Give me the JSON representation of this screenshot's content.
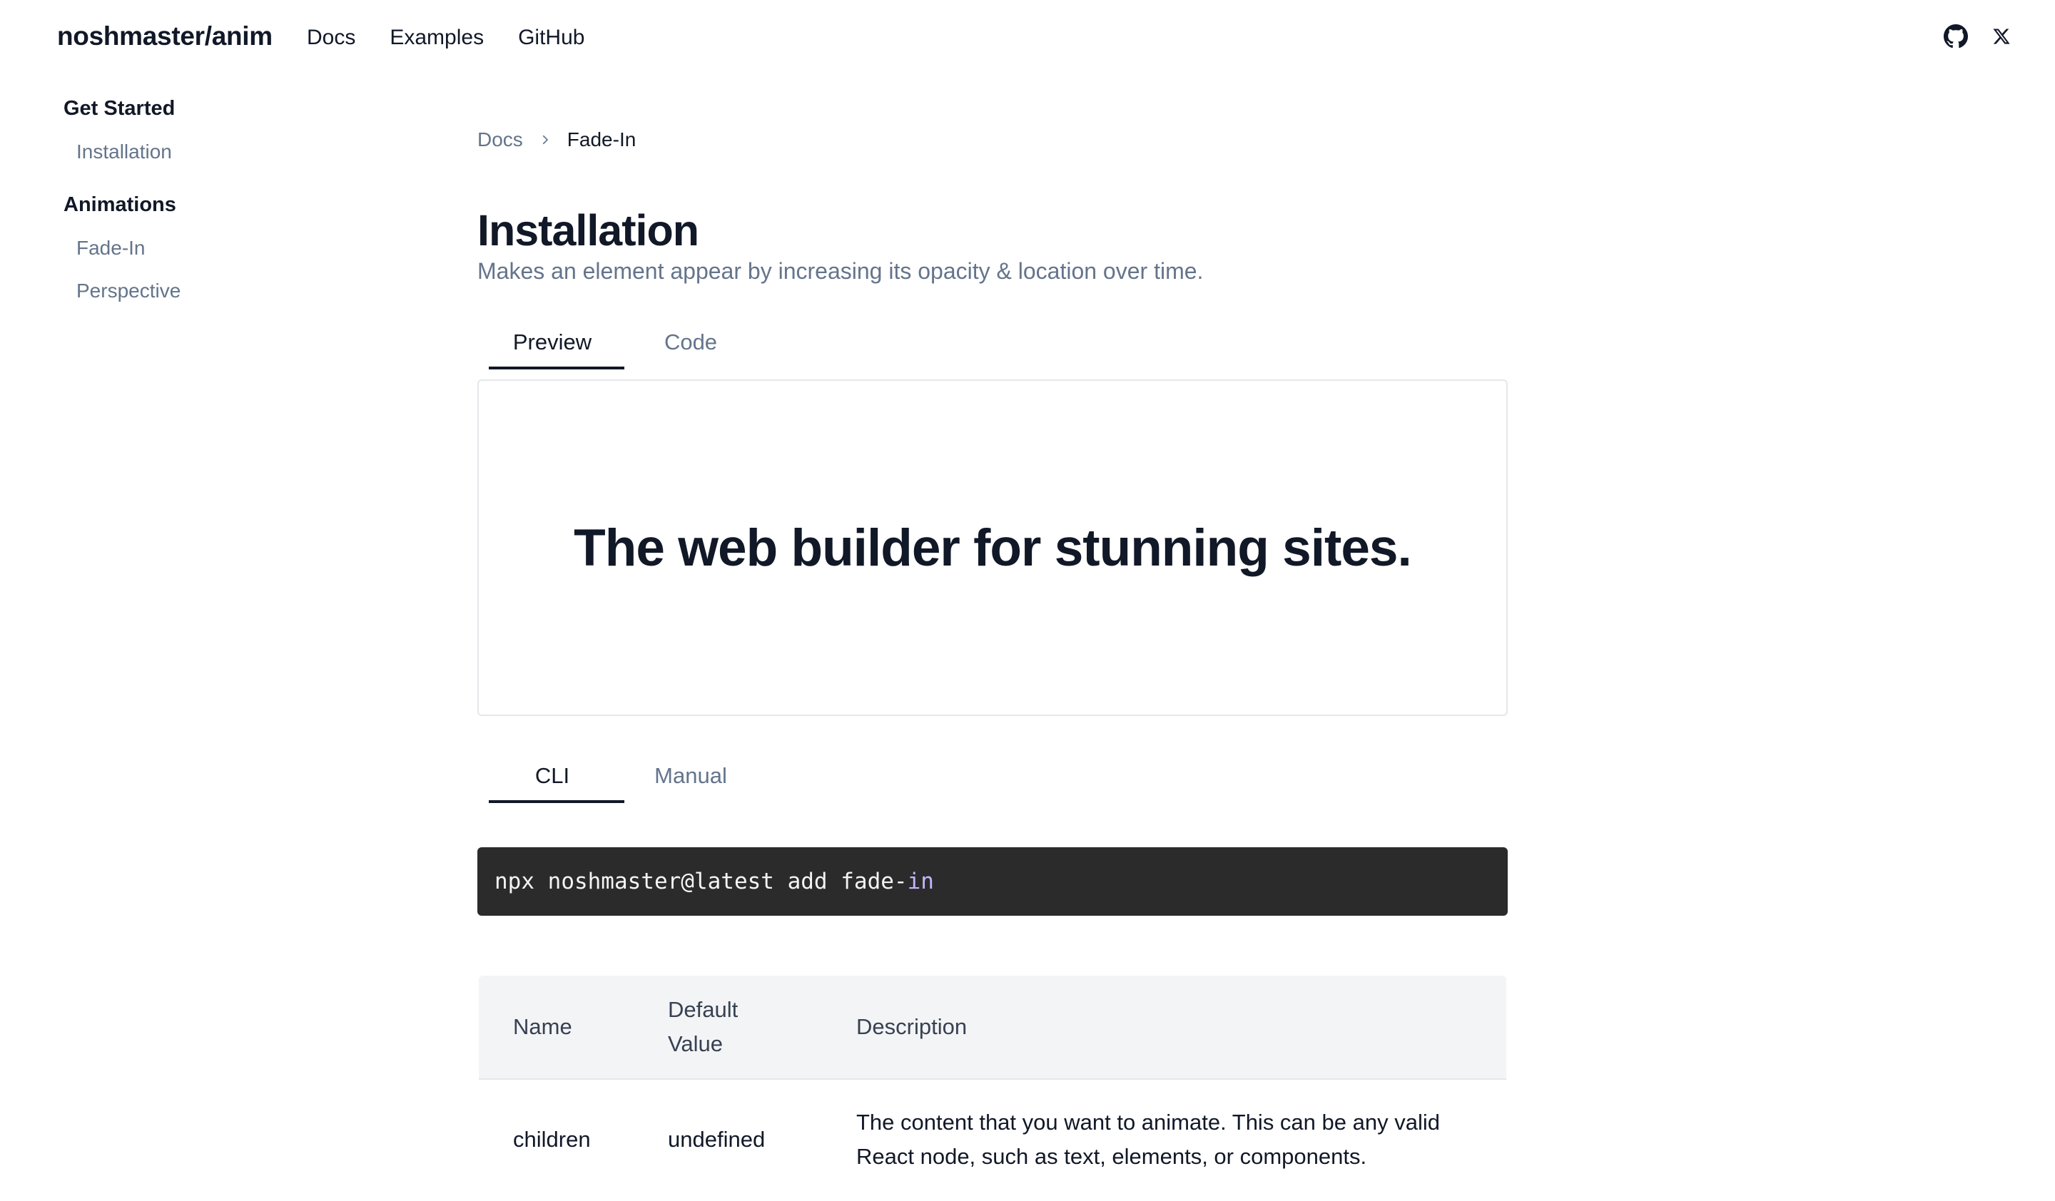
{
  "header": {
    "brand": "noshmaster/anim",
    "nav": [
      "Docs",
      "Examples",
      "GitHub"
    ],
    "icons": [
      "github-icon",
      "x-icon"
    ]
  },
  "sidebar": {
    "groups": [
      {
        "heading": "Get Started",
        "items": [
          "Installation"
        ]
      },
      {
        "heading": "Animations",
        "items": [
          "Fade-In",
          "Perspective"
        ]
      }
    ]
  },
  "breadcrumb": {
    "parent": "Docs",
    "current": "Fade-In"
  },
  "page": {
    "title": "Installation",
    "subtitle": "Makes an element appear by increasing its opacity & location over time."
  },
  "preview_tabs": {
    "tabs": [
      "Preview",
      "Code"
    ],
    "active": "Preview"
  },
  "preview": {
    "heading": "The web builder for stunning sites."
  },
  "install_tabs": {
    "tabs": [
      "CLI",
      "Manual"
    ],
    "active": "CLI"
  },
  "code": {
    "command": "npx noshmaster@latest add fade-",
    "command_tail": "in"
  },
  "props_table": {
    "headers": [
      "Name",
      "Default Value",
      "Description"
    ],
    "rows": [
      [
        "children",
        "undefined",
        "The content that you want to animate. This can be any valid React node, such as text, elements, or components."
      ]
    ]
  },
  "colors": {
    "accent": "#111827",
    "muted": "#64748b",
    "code_bg": "#2b2b2b",
    "table_header_bg": "#f3f4f6"
  }
}
